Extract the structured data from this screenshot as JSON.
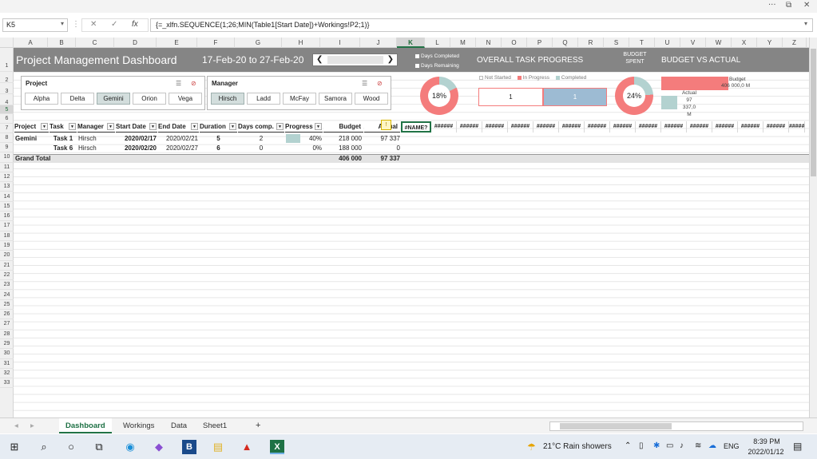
{
  "window": {
    "controls": [
      "···",
      "⧉",
      "✕"
    ]
  },
  "formula_bar": {
    "cell_ref": "K5",
    "cancel_symbol": "✕",
    "enter_symbol": "✓",
    "fx_symbol": "fx",
    "formula": "{=_xlfn.SEQUENCE(1;26;MIN(Table1[Start Date])+Workings!P2;1)}"
  },
  "columns": [
    "A",
    "B",
    "C",
    "D",
    "E",
    "F",
    "G",
    "H",
    "I",
    "J",
    "K",
    "L",
    "M",
    "N",
    "O",
    "P",
    "Q",
    "R",
    "S",
    "T",
    "U",
    "V",
    "W",
    "X",
    "Y",
    "Z"
  ],
  "rows": [
    "1",
    "2",
    "3",
    "4",
    "5",
    "6",
    "7",
    "8",
    "9",
    "10",
    "11",
    "12",
    "13",
    "14",
    "15",
    "16",
    "17",
    "18",
    "19",
    "20",
    "21",
    "22",
    "23",
    "24",
    "25",
    "26",
    "27",
    "28",
    "29",
    "30",
    "31",
    "32",
    "33"
  ],
  "dashboard": {
    "title": "Project Management Dashboard",
    "date_range": "17-Feb-20 to 27-Feb-20",
    "scroll_left": "❮",
    "scroll_right": "❯",
    "legend_days_completed": "Days Completed",
    "legend_days_remaining": "Days Remaining",
    "overall_task_progress": "OVERALL TASK PROGRESS",
    "budget_spent_line1": "BUDGET",
    "budget_spent_line2": "SPENT",
    "budget_vs_actual": "BUDGET VS ACTUAL",
    "days_donut_pct": "18%",
    "budget_donut_pct": "24%",
    "status_not_started": "Not Started",
    "status_in_progress": "In Progress",
    "status_completed": "Completed",
    "task_box_1": "1",
    "task_box_2": "1",
    "bva_budget_label": "Budget",
    "bva_budget_value": "406 000,0  M",
    "bva_actual_label": "Actual",
    "bva_actual_value_1": "97",
    "bva_actual_value_2": "337,0",
    "bva_actual_value_3": "M",
    "colors": {
      "banner": "#858585",
      "pink": "#f47c7c",
      "teal": "#b3d2d0",
      "blue": "#9dbbd3"
    }
  },
  "slicers": {
    "project": {
      "title": "Project",
      "items": [
        "Alpha",
        "Delta",
        "Gemini",
        "Orion",
        "Vega"
      ],
      "selected": "Gemini"
    },
    "manager": {
      "title": "Manager",
      "items": [
        "Hirsch",
        "Ladd",
        "McFay",
        "Samora",
        "Wood"
      ],
      "selected": "Hirsch"
    }
  },
  "table": {
    "headers": [
      "Project",
      "Task",
      "Manager",
      "Start Date",
      "End Date",
      "Duration",
      "Days comp.",
      "Progress",
      "Budget",
      "Actual"
    ],
    "error_cell": "#NAME?",
    "hash": "######",
    "rows": [
      {
        "project": "Gemini",
        "task": "Task 1",
        "manager": "Hirsch",
        "start": "2020/02/17",
        "end": "2020/02/21",
        "duration": "5",
        "days": "2",
        "progress": "40%",
        "progress_value": 0.4,
        "budget": "218 000",
        "actual": "97 337"
      },
      {
        "project": "",
        "task": "Task 6",
        "manager": "Hirsch",
        "start": "2020/02/20",
        "end": "2020/02/27",
        "duration": "6",
        "days": "0",
        "progress": "0%",
        "progress_value": 0,
        "budget": "188 000",
        "actual": "0"
      }
    ],
    "grand_total_label": "Grand Total",
    "grand_total_budget": "406 000",
    "grand_total_actual": "97 337"
  },
  "sheet_tabs": {
    "active": "Dashboard",
    "tabs": [
      "Dashboard",
      "Workings",
      "Data",
      "Sheet1"
    ],
    "add": "+"
  },
  "taskbar": {
    "weather": "21°C  Rain showers",
    "lang": "ENG",
    "time": "8:39 PM",
    "date": "2022/01/12"
  }
}
